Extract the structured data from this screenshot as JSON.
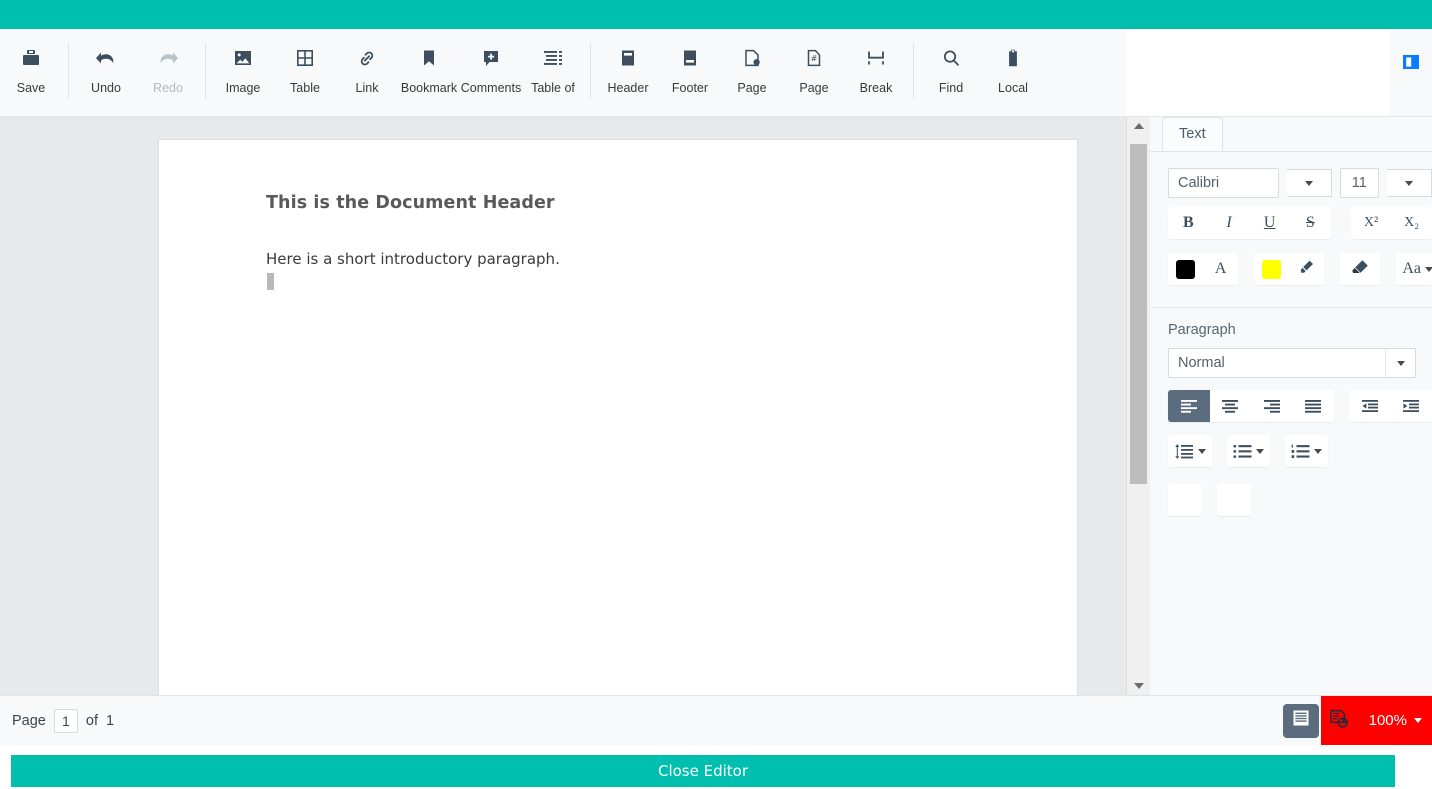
{
  "theme": {
    "accent_teal": "#00bfae",
    "toolbar_bg": "#f7f9fa",
    "doc_bg": "#e7eaec",
    "active_btn": "#5a6c7d",
    "alert_red": "#ff0000",
    "panel_toggle_blue": "#0a7cff"
  },
  "toolbar": {
    "groups": [
      {
        "items": [
          {
            "label": "Save",
            "icon": "save-icon",
            "disabled": false
          }
        ]
      },
      {
        "items": [
          {
            "label": "Undo",
            "icon": "undo-arrow-icon",
            "disabled": false
          },
          {
            "label": "Redo",
            "icon": "redo-arrow-icon",
            "disabled": true
          }
        ]
      },
      {
        "items": [
          {
            "label": "Image",
            "icon": "image-icon",
            "disabled": false
          },
          {
            "label": "Table",
            "icon": "table-grid-icon",
            "disabled": false
          },
          {
            "label": "Link",
            "icon": "link-chain-icon",
            "disabled": false
          },
          {
            "label": "Bookmark",
            "icon": "bookmark-icon",
            "disabled": false
          },
          {
            "label": "Comments",
            "icon": "comment-add-icon",
            "disabled": false
          },
          {
            "label": "Table of",
            "icon": "table-of-contents-icon",
            "disabled": false
          }
        ]
      },
      {
        "items": [
          {
            "label": "Header",
            "icon": "page-header-icon",
            "disabled": false
          },
          {
            "label": "Footer",
            "icon": "page-footer-icon",
            "disabled": false
          },
          {
            "label": "Page",
            "icon": "page-setup-gear-icon",
            "disabled": false
          },
          {
            "label": "Page",
            "icon": "page-number-hash-icon",
            "disabled": false
          },
          {
            "label": "Break",
            "icon": "page-break-icon",
            "disabled": false
          }
        ]
      },
      {
        "items": [
          {
            "label": "Find",
            "icon": "search-magnifier-icon",
            "disabled": false
          },
          {
            "label": "Local",
            "icon": "clipboard-icon",
            "disabled": false
          }
        ]
      }
    ],
    "panel_toggle_icon": "toggle-side-panel-icon"
  },
  "document": {
    "heading": "This is the Document Header",
    "paragraph": "Here is a short introductory paragraph."
  },
  "side_panel": {
    "tabs": [
      {
        "label": "Text",
        "active": true
      }
    ],
    "text_section": {
      "font_family": "Calibri",
      "font_size": "11",
      "buttons": [
        {
          "label": "B",
          "name": "bold-button"
        },
        {
          "label": "I",
          "name": "italic-button"
        },
        {
          "label": "U",
          "name": "underline-button"
        },
        {
          "label": "S",
          "name": "strikethrough-button"
        }
      ],
      "script_buttons": [
        {
          "label": "X²",
          "name": "superscript-button"
        },
        {
          "label": "X₂",
          "name": "subscript-button"
        }
      ],
      "color_swatch": "#000000",
      "font_color_glyph": "A",
      "highlight_swatch": "#ffff00",
      "highlight_glyph": "highlighter-pen-icon",
      "clear_format_glyph": "eraser-icon",
      "change_case_glyph": "Aa"
    },
    "paragraph_section": {
      "title": "Paragraph",
      "style": "Normal",
      "align_buttons": [
        {
          "name": "align-left-button",
          "active": true
        },
        {
          "name": "align-center-button",
          "active": false
        },
        {
          "name": "align-right-button",
          "active": false
        },
        {
          "name": "align-justify-button",
          "active": false
        }
      ],
      "indent_buttons": [
        {
          "name": "decrease-indent-button"
        },
        {
          "name": "increase-indent-button"
        }
      ],
      "list_buttons": [
        {
          "name": "line-spacing-button"
        },
        {
          "name": "bulleted-list-button"
        },
        {
          "name": "numbered-list-button"
        }
      ],
      "extra_buttons": [
        {
          "name": "paragraph-extra-button-1"
        },
        {
          "name": "paragraph-extra-button-2"
        }
      ]
    }
  },
  "status_bar": {
    "page_label": "Page",
    "page_value": "1",
    "of_label": "of",
    "page_total": "1",
    "view_page_icon": "page-layout-view-icon",
    "view_web_icon": "web-layout-view-icon",
    "zoom_level": "100%"
  },
  "footer": {
    "close_editor_label": "Close Editor"
  }
}
